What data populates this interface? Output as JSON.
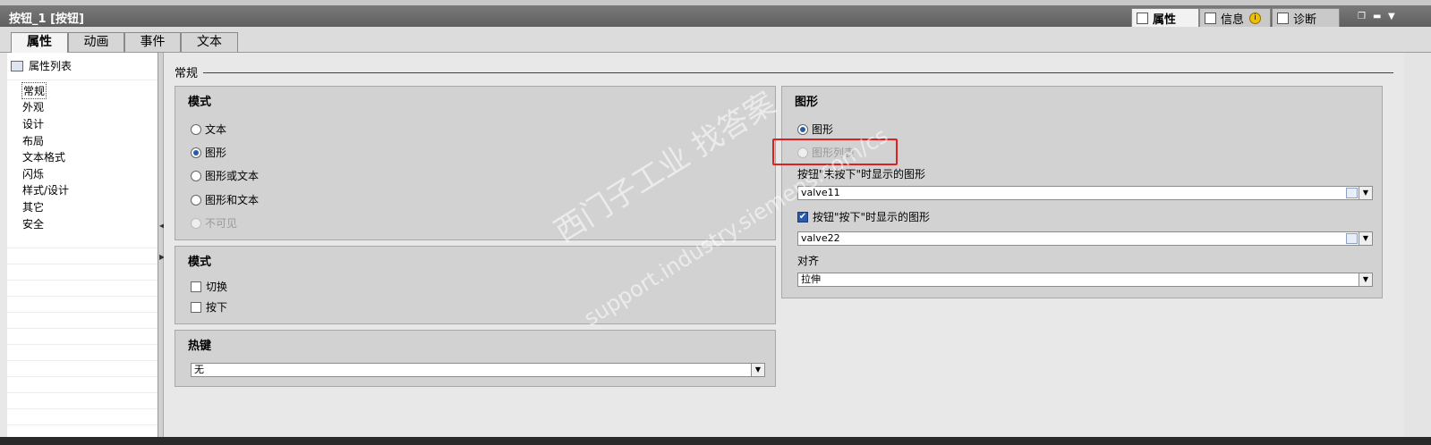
{
  "window": {
    "title": "按钮_1 [按钮]"
  },
  "inspector_tabs": [
    {
      "label": "属性",
      "active": true
    },
    {
      "label": "信息",
      "badge": "i"
    },
    {
      "label": "诊断"
    }
  ],
  "tabs": [
    "属性",
    "动画",
    "事件",
    "文本"
  ],
  "left_panel": {
    "header": "属性列表",
    "items": [
      "常规",
      "外观",
      "设计",
      "布局",
      "文本格式",
      "闪烁",
      "样式/设计",
      "其它",
      "安全"
    ],
    "selected_index": 0
  },
  "section": {
    "title": "常规"
  },
  "mode_box": {
    "title": "模式",
    "options": [
      "文本",
      "图形",
      "图形或文本",
      "图形和文本",
      "不可见"
    ],
    "selected": "图形",
    "disabled": [
      "不可见"
    ]
  },
  "mode2_box": {
    "title": "模式",
    "checks": [
      {
        "label": "切换",
        "checked": false
      },
      {
        "label": "按下",
        "checked": false
      }
    ]
  },
  "hotkey_box": {
    "title": "热键",
    "value": "无"
  },
  "graphic_box": {
    "title": "图形",
    "opt_graphic": "图形",
    "opt_graphic_list": "图形列表",
    "not_pressed_label": "按钮\"未按下\"时显示的图形",
    "not_pressed_value": "valve11",
    "pressed_label": "按钮\"按下\"时显示的图形",
    "pressed_checked": true,
    "pressed_value": "valve22",
    "align_label": "对齐",
    "align_value": "拉伸"
  },
  "watermark": {
    "line1": "西门子工业 找答案",
    "line2": "support.industry.siemens.com/cs"
  },
  "colors": {
    "highlight": "#e02020",
    "accent": "#2a5aa8"
  }
}
